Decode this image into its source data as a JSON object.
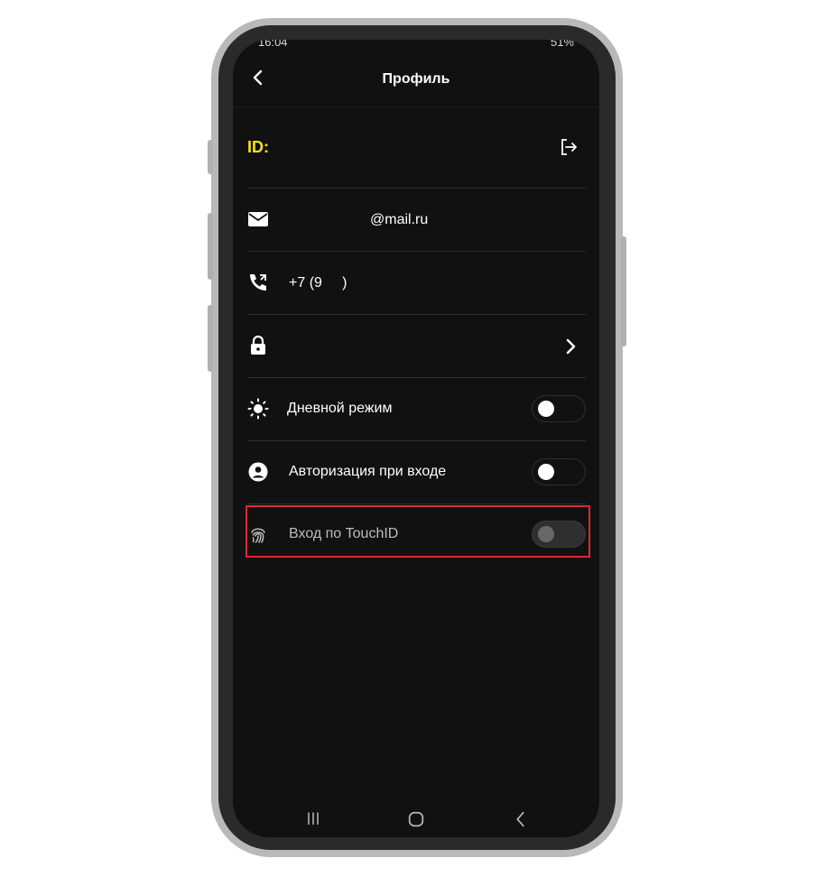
{
  "status_bar": {
    "time": "16:04",
    "indicators": "51%"
  },
  "header": {
    "title": "Профиль",
    "back_icon": "chevron-left-icon"
  },
  "profile": {
    "id_label": "ID:",
    "logout_icon": "logout-icon",
    "email": "@mail.ru",
    "phone": "+7 (9     )",
    "password_row_icon": "lock-icon"
  },
  "settings": [
    {
      "label": "Дневной режим",
      "icon": "sun-icon",
      "enabled": false,
      "disabled": false
    },
    {
      "label": "Авторизация при входе",
      "icon": "account-circle-icon",
      "enabled": false,
      "disabled": false
    },
    {
      "label": "Вход по TouchID",
      "icon": "fingerprint-icon",
      "enabled": false,
      "disabled": true
    }
  ],
  "colors": {
    "background": "#111111",
    "accent_id": "#F2E21B",
    "highlight": "#E0282D"
  },
  "nav_icons": [
    "recent-apps-icon",
    "home-icon",
    "back-icon"
  ]
}
